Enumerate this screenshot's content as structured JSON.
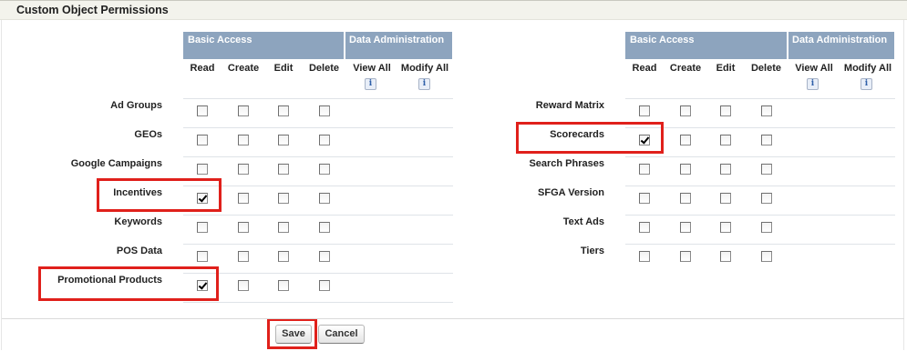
{
  "section": {
    "title": "Custom Object Permissions"
  },
  "headers": {
    "basic_access": "Basic Access",
    "data_administration": "Data Administration",
    "columns": [
      "Read",
      "Create",
      "Edit",
      "Delete",
      "View All",
      "Modify All"
    ],
    "info_icon_glyph": "i"
  },
  "left_rows": [
    {
      "label": "Ad Groups",
      "read": false,
      "create": false,
      "edit": false,
      "delete": false
    },
    {
      "label": "GEOs",
      "read": false,
      "create": false,
      "edit": false,
      "delete": false
    },
    {
      "label": "Google Campaigns",
      "read": false,
      "create": false,
      "edit": false,
      "delete": false
    },
    {
      "label": "Incentives",
      "read": true,
      "create": false,
      "edit": false,
      "delete": false
    },
    {
      "label": "Keywords",
      "read": false,
      "create": false,
      "edit": false,
      "delete": false
    },
    {
      "label": "POS Data",
      "read": false,
      "create": false,
      "edit": false,
      "delete": false
    },
    {
      "label": "Promotional Products",
      "read": true,
      "create": false,
      "edit": false,
      "delete": false
    }
  ],
  "right_rows": [
    {
      "label": "Reward Matrix",
      "read": false,
      "create": false,
      "edit": false,
      "delete": false
    },
    {
      "label": "Scorecards",
      "read": true,
      "create": false,
      "edit": false,
      "delete": false
    },
    {
      "label": "Search Phrases",
      "read": false,
      "create": false,
      "edit": false,
      "delete": false
    },
    {
      "label": "SFGA Version",
      "read": false,
      "create": false,
      "edit": false,
      "delete": false
    },
    {
      "label": "Text Ads",
      "read": false,
      "create": false,
      "edit": false,
      "delete": false
    },
    {
      "label": "Tiers",
      "read": false,
      "create": false,
      "edit": false,
      "delete": false
    }
  ],
  "buttons": {
    "save": "Save",
    "cancel": "Cancel"
  },
  "colors": {
    "header_blue": "#8da4be",
    "highlight_red": "#e0201b",
    "section_bg": "#f3f3ec"
  }
}
